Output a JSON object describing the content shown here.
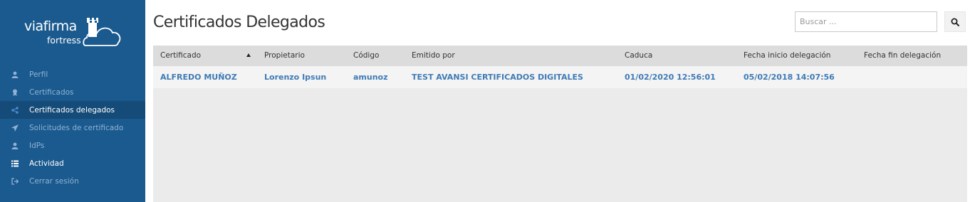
{
  "brand": {
    "name": "viafirma",
    "product": "fortress"
  },
  "sidebar": {
    "items": [
      {
        "label": "Perfil",
        "icon": "user-icon"
      },
      {
        "label": "Certificados",
        "icon": "certificate-icon"
      },
      {
        "label": "Certificados delegados",
        "icon": "share-icon"
      },
      {
        "label": "Solicitudes de certificado",
        "icon": "send-icon"
      },
      {
        "label": "IdPs",
        "icon": "user-icon"
      },
      {
        "label": "Actividad",
        "icon": "list-icon"
      },
      {
        "label": "Cerrar sesión",
        "icon": "sign-out-icon"
      }
    ]
  },
  "page": {
    "title": "Certificados Delegados"
  },
  "search": {
    "placeholder": "Buscar ..."
  },
  "table": {
    "columns": [
      "Certificado",
      "Propietario",
      "Código",
      "Emitido por",
      "Caduca",
      "Fecha inicio delegación",
      "Fecha fin delegación"
    ],
    "sorted_column": "Certificado",
    "sort_direction": "ascending",
    "rows": [
      {
        "certificado": "ALFREDO MUÑOZ",
        "propietario": "Lorenzo Ipsun",
        "codigo": "amunoz",
        "emitido_por": "TEST AVANSI CERTIFICADOS DIGITALES",
        "caduca": "01/02/2020 12:56:01",
        "fecha_inicio": "05/02/2018 14:07:56",
        "fecha_fin": ""
      }
    ]
  },
  "colors": {
    "sidebar_bg": "#1b5a8e",
    "sidebar_active_bg": "#154b78",
    "link": "#3f7ab5"
  }
}
